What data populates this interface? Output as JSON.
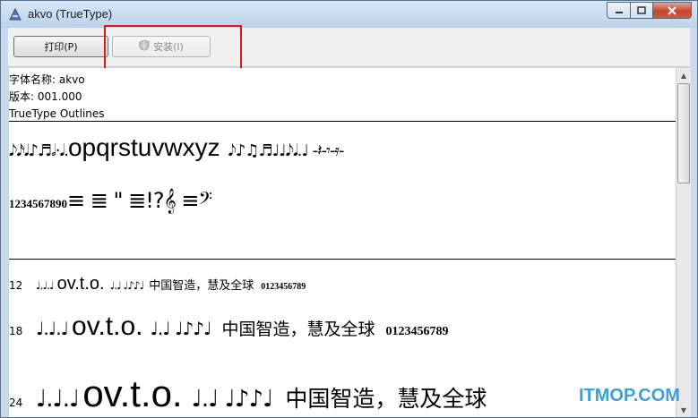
{
  "window": {
    "title": "akvo (TrueType)",
    "colors": {
      "frame": "#c9dbef",
      "highlight": "#e01818",
      "close": "#c7462e",
      "watermark": "#3ba1d8"
    }
  },
  "toolbar": {
    "print_label": "打印(P)",
    "install_label": "安装(I)"
  },
  "font_info": {
    "name_line": "字体名称: akvo",
    "version_line": "版本: 001.000",
    "outline_line": "TrueType Outlines"
  },
  "preview": {
    "glyph_row1_left": "𝅘𝅥𝅮𝅘𝅥𝅯𝅘𝅥♪♬𝅗𝅥·𝅘𝅥.",
    "glyph_row1_latin": "opqrstuvwxyz",
    "glyph_row1_right": "𝅘𝅥𝅮♪♫♬♩♩𝅘𝅥𝅮𝅘𝅥.♩ -𝄽-𝄾-𝄿-",
    "glyph_row2_digits": "1234567890",
    "glyph_row2_rest": "≡  ≣ \" ≣!?𝄞 ≡𝄢"
  },
  "samples": [
    {
      "size": "12",
      "notes_left": "♩.♩.♩",
      "latin": "ov.t.o.",
      "notes_right": "♩.♩ ♩♪♪♩",
      "cjk": "中国智造，慧及全球",
      "digits": "0123456789"
    },
    {
      "size": "18",
      "notes_left": "♩.♩.♩",
      "latin": "ov.t.o.",
      "notes_right": "♩.♩ ♩♪♪♩",
      "cjk": "中国智造，慧及全球",
      "digits": "0123456789"
    },
    {
      "size": "24",
      "notes_left": "♩.♩.♩",
      "latin": "ov.t.o.",
      "notes_right": "♩.♩ ♩♪♪♩",
      "cjk": "中国智造，慧及全球",
      "digits": ""
    }
  ],
  "watermark": "ITMOP.COM"
}
